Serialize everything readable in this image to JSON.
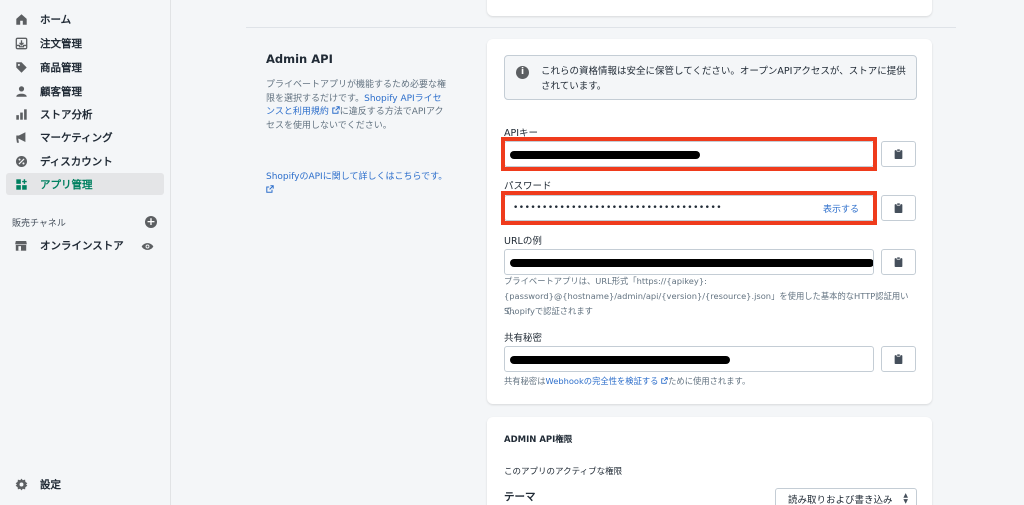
{
  "sidebar": {
    "items": [
      {
        "label": "ホーム",
        "icon": "home-icon"
      },
      {
        "label": "注文管理",
        "icon": "orders-icon"
      },
      {
        "label": "商品管理",
        "icon": "tag-icon"
      },
      {
        "label": "顧客管理",
        "icon": "customer-icon"
      },
      {
        "label": "ストア分析",
        "icon": "analytics-icon"
      },
      {
        "label": "マーケティング",
        "icon": "megaphone-icon"
      },
      {
        "label": "ディスカウント",
        "icon": "discount-icon"
      },
      {
        "label": "アプリ管理",
        "icon": "apps-icon",
        "active": true
      }
    ],
    "channels_heading": "販売チャネル",
    "channel_item": "オンラインストア",
    "settings_label": "設定"
  },
  "section": {
    "title": "Admin API",
    "desc_before": "プライベートアプリが機能するため必要な権限を選択するだけです。",
    "desc_link": "Shopify APIライセンスと利用規約",
    "desc_after": "に違反する方法でAPIアクセスを使用しないでください。",
    "learn_more": "ShopifyのAPIに関して詳しくはこちらです。"
  },
  "banner": {
    "text": "これらの資格情報は安全に保管してください。オープンAPIアクセスが、ストアに提供されています。"
  },
  "fields": {
    "api_key_label": "APIキー",
    "password_label": "パスワード",
    "password_value": "••••••••••••••••••••••••••••••••••••",
    "show_label": "表示する",
    "url_label": "URLの例",
    "url_help_1": "プライベートアプリは、URL形式「https://{apikey}:",
    "url_help_2": "{password}@{hostname}/admin/api/{version}/{resource}.json」を使用した基本的なHTTP認証用いて、",
    "url_help_3": "Shopifyで認証されます",
    "secret_label": "共有秘密",
    "secret_help_before": "共有秘密は",
    "secret_help_link": "Webhookの完全性を検証する",
    "secret_help_after": "ために使用されます。"
  },
  "permissions": {
    "heading": "ADMIN API権限",
    "subheading": "このアプリのアクティブな権限",
    "theme_label": "テーマ",
    "select_value": "読み取りおよび書き込み"
  },
  "colors": {
    "accent": "#008060",
    "link": "#2c6ecb",
    "highlight": "#ef3b1c"
  }
}
